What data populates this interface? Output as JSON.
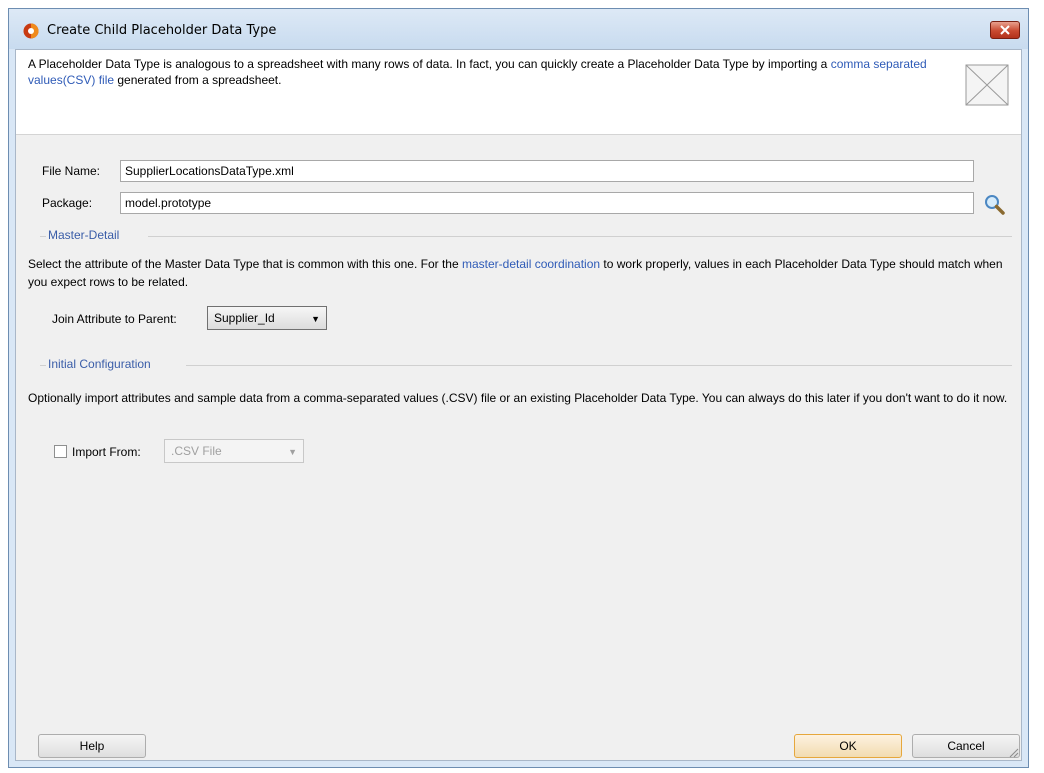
{
  "window": {
    "title": "Create Child Placeholder Data Type"
  },
  "header": {
    "text_before_link": "A Placeholder Data Type is analogous to a spreadsheet with many rows of data. In fact, you can quickly create a Placeholder Data Type by importing a ",
    "link": "comma separated values(CSV) file",
    "text_after_link": " generated from a spreadsheet."
  },
  "form": {
    "file_name_label": "File Name:",
    "file_name_value": "SupplierLocationsDataType.xml",
    "package_label": "Package:",
    "package_value": "model.prototype"
  },
  "master_detail": {
    "section_label": "Master-Detail",
    "text_before_link": "Select the attribute of the Master Data Type that is common with this one. For the ",
    "link": "master-detail coordination",
    "text_after_link": " to work properly, values in each Placeholder Data Type should match when you expect rows to be related.",
    "join_label": "Join Attribute to Parent:",
    "join_value": "Supplier_Id"
  },
  "initial_config": {
    "section_label": "Initial Configuration",
    "text": "Optionally import attributes and sample data from a comma-separated values (.CSV) file or an existing Placeholder Data Type. You can always do this later if you don't want to do it now.",
    "import_label": "Import From:",
    "import_value": ".CSV File",
    "import_checked": false
  },
  "buttons": {
    "help": "Help",
    "ok": "OK",
    "cancel": "Cancel"
  },
  "icons": {
    "app": "jdeveloper-icon",
    "close": "close-icon",
    "header_image": "placeholder-image-icon",
    "search": "search-icon"
  }
}
